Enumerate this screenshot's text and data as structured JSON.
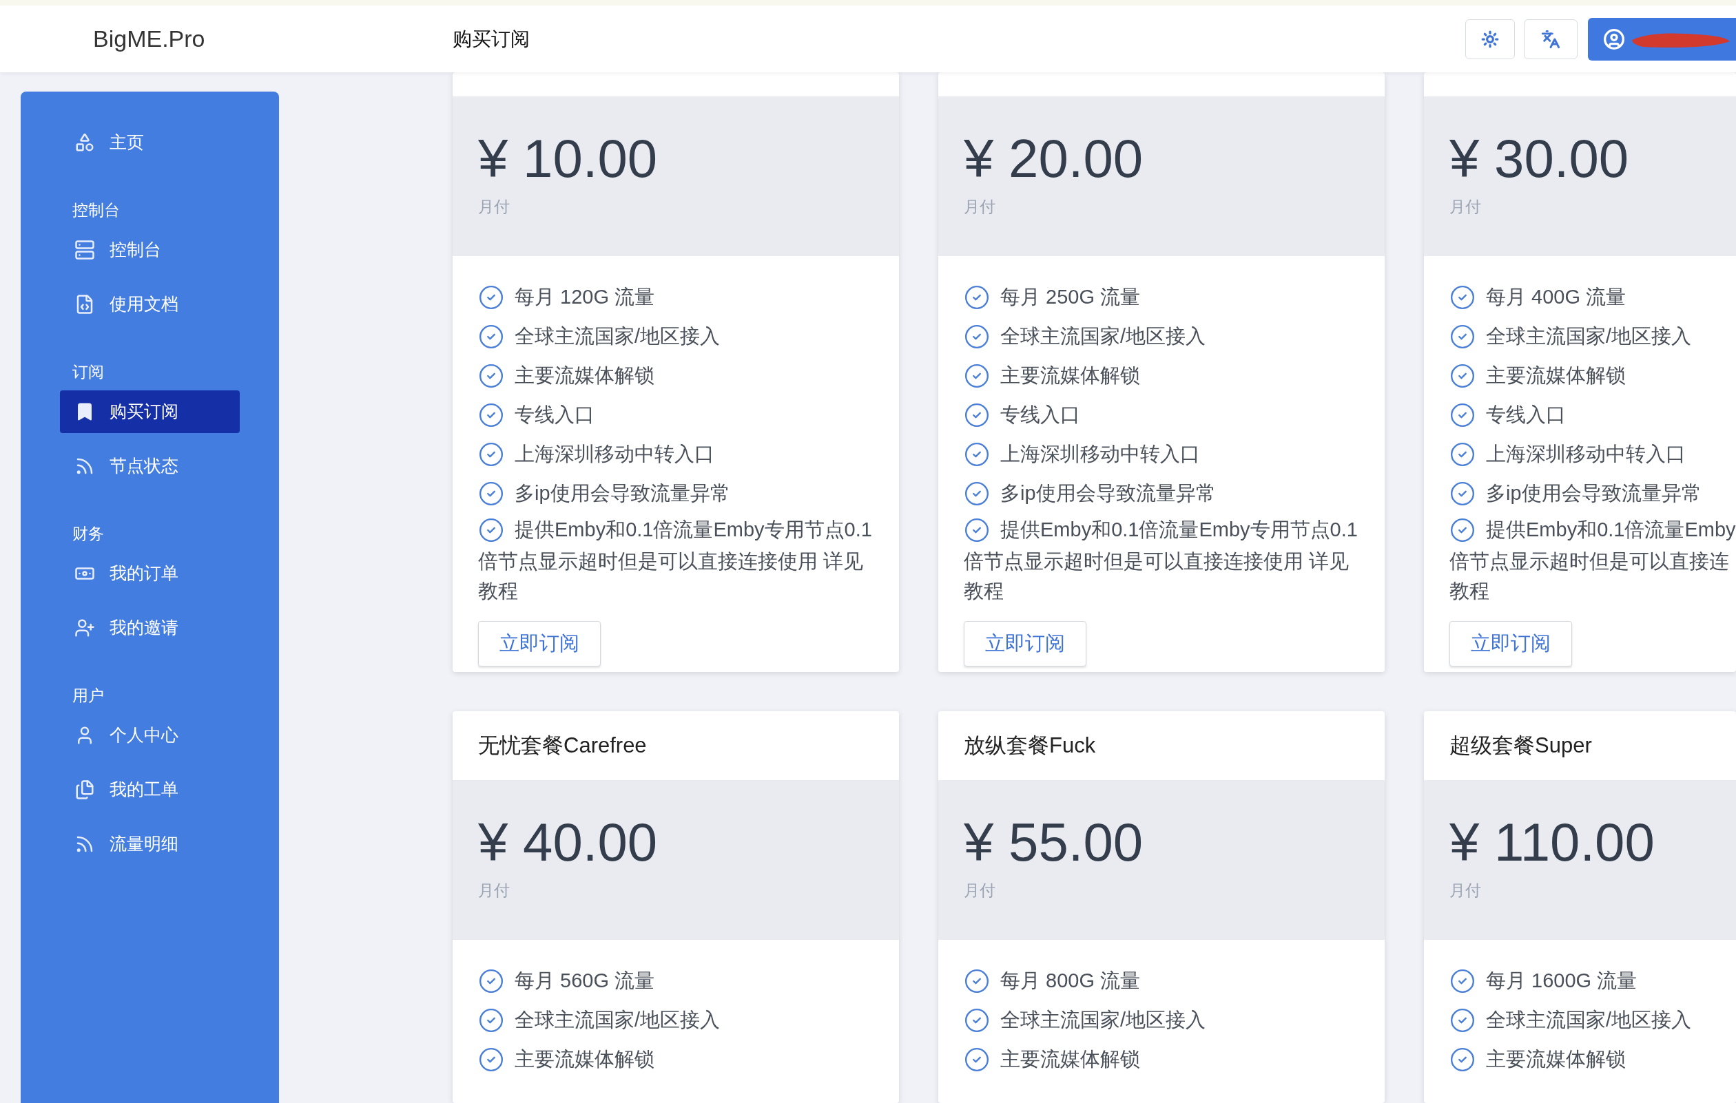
{
  "header": {
    "logo": "BigME.Pro",
    "page_title": "购买订阅"
  },
  "sidebar": {
    "sections": [
      {
        "items": [
          {
            "label": "主页",
            "selected": false
          }
        ]
      },
      {
        "title": "控制台",
        "items": [
          {
            "label": "控制台",
            "selected": false
          },
          {
            "label": "使用文档",
            "selected": false
          }
        ]
      },
      {
        "title": "订阅",
        "items": [
          {
            "label": "购买订阅",
            "selected": true
          },
          {
            "label": "节点状态",
            "selected": false
          }
        ]
      },
      {
        "title": "财务",
        "items": [
          {
            "label": "我的订单",
            "selected": false
          },
          {
            "label": "我的邀请",
            "selected": false
          }
        ]
      },
      {
        "title": "用户",
        "items": [
          {
            "label": "个人中心",
            "selected": false
          },
          {
            "label": "我的工单",
            "selected": false
          },
          {
            "label": "流量明细",
            "selected": false
          }
        ]
      }
    ]
  },
  "plans": [
    {
      "price": "¥ 10.00",
      "period": "月付",
      "features": [
        {
          "lines": [
            "每月 120G 流量"
          ]
        },
        {
          "lines": [
            "全球主流国家/地区接入"
          ]
        },
        {
          "lines": [
            "主要流媒体解锁"
          ]
        },
        {
          "lines": [
            "专线入口"
          ]
        },
        {
          "lines": [
            "上海深圳移动中转入口"
          ]
        },
        {
          "lines": [
            "多ip使用会导致流量异常"
          ]
        },
        {
          "lines": [
            "提供Emby和0.1倍流量Emby专用节点0.1",
            "倍节点显示超时但是可以直接连接使用 详见",
            "教程"
          ]
        }
      ],
      "button": "立即订阅"
    },
    {
      "price": "¥ 20.00",
      "period": "月付",
      "features": [
        {
          "lines": [
            "每月 250G 流量"
          ]
        },
        {
          "lines": [
            "全球主流国家/地区接入"
          ]
        },
        {
          "lines": [
            "主要流媒体解锁"
          ]
        },
        {
          "lines": [
            "专线入口"
          ]
        },
        {
          "lines": [
            "上海深圳移动中转入口"
          ]
        },
        {
          "lines": [
            "多ip使用会导致流量异常"
          ]
        },
        {
          "lines": [
            "提供Emby和0.1倍流量Emby专用节点0.1",
            "倍节点显示超时但是可以直接连接使用 详见",
            "教程"
          ]
        }
      ],
      "button": "立即订阅"
    },
    {
      "price": "¥ 30.00",
      "period": "月付",
      "features": [
        {
          "lines": [
            "每月 400G 流量"
          ]
        },
        {
          "lines": [
            "全球主流国家/地区接入"
          ]
        },
        {
          "lines": [
            "主要流媒体解锁"
          ]
        },
        {
          "lines": [
            "专线入口"
          ]
        },
        {
          "lines": [
            "上海深圳移动中转入口"
          ]
        },
        {
          "lines": [
            "多ip使用会导致流量异常"
          ]
        },
        {
          "lines": [
            "提供Emby和0.1倍流量Emby",
            "倍节点显示超时但是可以直接连",
            "教程"
          ]
        }
      ],
      "button": "立即订阅"
    },
    {
      "title": "无忧套餐Carefree",
      "price": "¥ 40.00",
      "period": "月付",
      "features": [
        {
          "lines": [
            "每月 560G 流量"
          ]
        },
        {
          "lines": [
            "全球主流国家/地区接入"
          ]
        },
        {
          "lines": [
            "主要流媒体解锁"
          ]
        }
      ]
    },
    {
      "title": "放纵套餐Fuck",
      "price": "¥ 55.00",
      "period": "月付",
      "features": [
        {
          "lines": [
            "每月 800G 流量"
          ]
        },
        {
          "lines": [
            "全球主流国家/地区接入"
          ]
        },
        {
          "lines": [
            "主要流媒体解锁"
          ]
        }
      ]
    },
    {
      "title": "超级套餐Super",
      "price": "¥ 110.00",
      "period": "月付",
      "features": [
        {
          "lines": [
            "每月 1600G 流量"
          ]
        },
        {
          "lines": [
            "全球主流国家/地区接入"
          ]
        },
        {
          "lines": [
            "主要流媒体解锁"
          ]
        }
      ]
    }
  ]
}
